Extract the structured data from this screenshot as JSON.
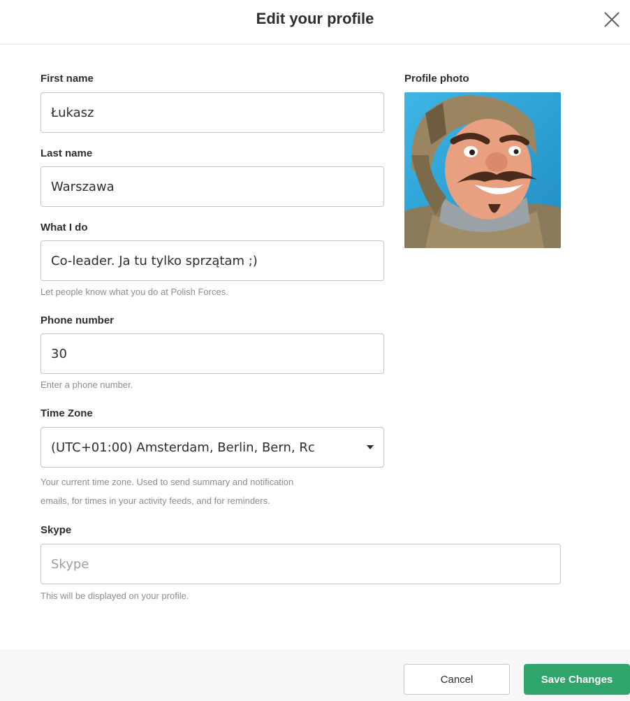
{
  "dialog": {
    "title": "Edit your profile"
  },
  "form": {
    "first_name": {
      "label": "First name",
      "value": "Łukasz"
    },
    "last_name": {
      "label": "Last name",
      "value": "Warszawa"
    },
    "what_i_do": {
      "label": "What I do",
      "value": "Co-leader. Ja tu tylko sprzątam ;)",
      "help": "Let people know what you do at Polish Forces."
    },
    "phone": {
      "label": "Phone number",
      "value": "30",
      "help": "Enter a phone number."
    },
    "time_zone": {
      "label": "Time Zone",
      "value": "(UTC+01:00) Amsterdam, Berlin, Bern, Rc",
      "help_line1": "Your current time zone. Used to send summary and notification",
      "help_line2": "emails, for times in your activity feeds, and for reminders."
    },
    "skype": {
      "label": "Skype",
      "placeholder": "Skype",
      "help": "This will be displayed on your profile."
    }
  },
  "profile_photo": {
    "label": "Profile photo",
    "icon": "knight-avatar-image"
  },
  "footer": {
    "cancel_label": "Cancel",
    "save_label": "Save Changes"
  },
  "colors": {
    "accent": "#2fa56b",
    "photo_background": "#2aa3d8"
  }
}
